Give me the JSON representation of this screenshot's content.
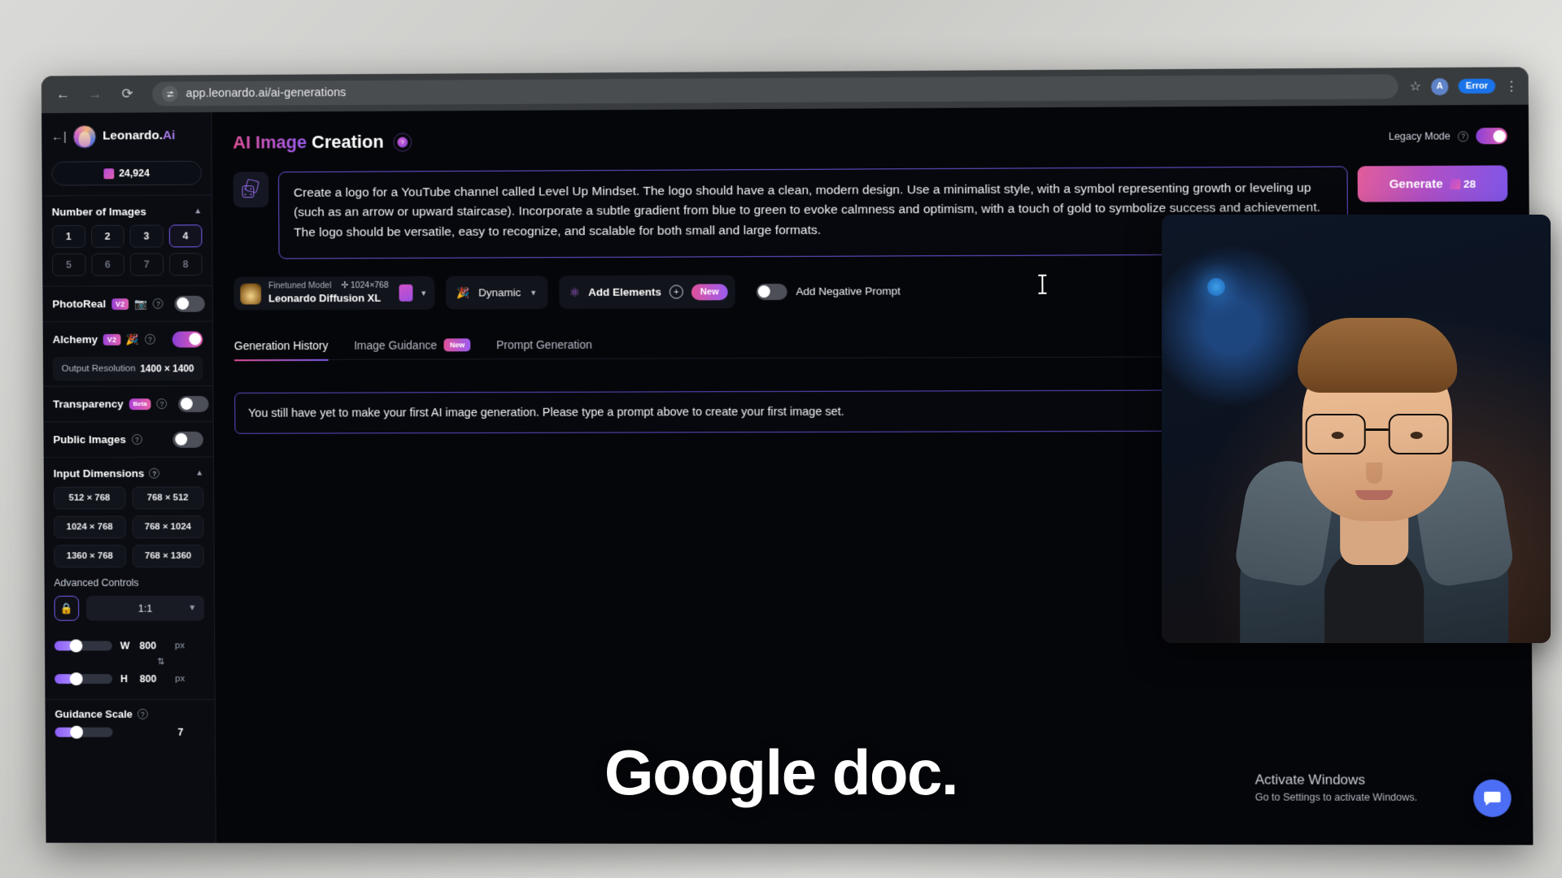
{
  "browser": {
    "back_icon": "back-arrow-icon",
    "forward_icon": "forward-arrow-icon",
    "reload_icon": "reload-icon",
    "site_settings_icon": "site-settings-icon",
    "url": "app.leonardo.ai/ai-generations",
    "bookmark_icon": "star-icon",
    "profile_initial": "A",
    "error_badge": "Error",
    "menu_icon": "kebab-menu-icon"
  },
  "sidebar": {
    "collapse_icon": "collapse-sidebar-icon",
    "brand_name": "Leonardo.",
    "brand_suffix": "Ai",
    "token_count": "24,924",
    "token_icon": "token-icon",
    "number_of_images": {
      "title": "Number of Images",
      "chevron": "chevron-up-icon",
      "options": [
        "1",
        "2",
        "3",
        "4",
        "5",
        "6",
        "7",
        "8"
      ],
      "selected": "4"
    },
    "photoreal": {
      "label": "PhotoReal",
      "badge": "V2",
      "icon": "camera-icon",
      "enabled": false
    },
    "alchemy": {
      "label": "Alchemy",
      "badge": "V2",
      "icon": "flask-icon",
      "enabled": true
    },
    "output_resolution": {
      "label": "Output Resolution",
      "value": "1400 × 1400"
    },
    "transparency": {
      "label": "Transparency",
      "badge": "Beta",
      "enabled": false
    },
    "public_images": {
      "label": "Public Images",
      "enabled": false
    },
    "input_dimensions": {
      "title": "Input Dimensions",
      "chevron": "chevron-up-icon",
      "presets": [
        "512 × 768",
        "768 × 512",
        "1024 × 768",
        "768 × 1024",
        "1360 × 768",
        "768 × 1360"
      ]
    },
    "advanced_controls": {
      "label": "Advanced Controls",
      "lock_icon": "lock-icon",
      "ratio": "1:1",
      "width": {
        "axis": "W",
        "value": "800",
        "unit": "px"
      },
      "height": {
        "axis": "H",
        "value": "800",
        "unit": "px"
      },
      "swap_icon": "swap-vertical-icon"
    },
    "guidance_scale": {
      "label": "Guidance Scale",
      "value": "7"
    },
    "help_icon": "help-circle-icon"
  },
  "main": {
    "title_accent": "AI Image",
    "title_rest": "Creation",
    "title_help_icon": "info-icon",
    "legacy_mode": {
      "label": "Legacy Mode",
      "help_icon": "help-circle-icon",
      "enabled": true
    },
    "dice_icon": "dice-randomize-icon",
    "prompt": "Create a logo for a YouTube channel called Level Up Mindset. The logo should have a clean, modern design. Use a minimalist style, with a symbol representing growth or leveling up (such as an arrow or upward staircase). Incorporate a subtle gradient from blue to green to evoke calmness and optimism, with a touch of gold to symbolize success and achievement. The logo should be versatile, easy to recognize, and scalable for both small and large formats.",
    "generate": {
      "label": "Generate",
      "cost": "28",
      "token_icon": "token-icon"
    },
    "model_chip": {
      "kind": "Finetuned Model",
      "resolution": "1024×768",
      "resolution_icon": "move-icon",
      "name": "Leonardo Diffusion XL",
      "swatch_icon": "model-preview-icon",
      "chevron": "chevron-down-icon"
    },
    "style_chip": {
      "icon": "flask-icon",
      "name": "Dynamic",
      "chevron": "chevron-down-icon"
    },
    "elements_chip": {
      "icon": "atom-icon",
      "label": "Add Elements",
      "plus_icon": "plus-circle-icon",
      "badge": "New"
    },
    "negative_prompt": {
      "label": "Add Negative Prompt",
      "enabled": false
    },
    "tabs": [
      {
        "label": "Generation History",
        "active": true,
        "badge": ""
      },
      {
        "label": "Image Guidance",
        "active": false,
        "badge": "New"
      },
      {
        "label": "Prompt Generation",
        "active": false,
        "badge": ""
      }
    ],
    "history_banner": "You still have yet to make your first AI image generation. Please type a prompt above to create your first image set."
  },
  "overlay": {
    "caption": "Google doc.",
    "activate_windows_title": "Activate Windows",
    "activate_windows_sub": "Go to Settings to activate Windows.",
    "intercom_icon": "chat-bubble-icon"
  },
  "colors": {
    "accent_purple": "#7b5cf0",
    "accent_pink": "#e0519a",
    "bg_dark": "#05060a",
    "sidebar_bg": "#0a0c12"
  }
}
